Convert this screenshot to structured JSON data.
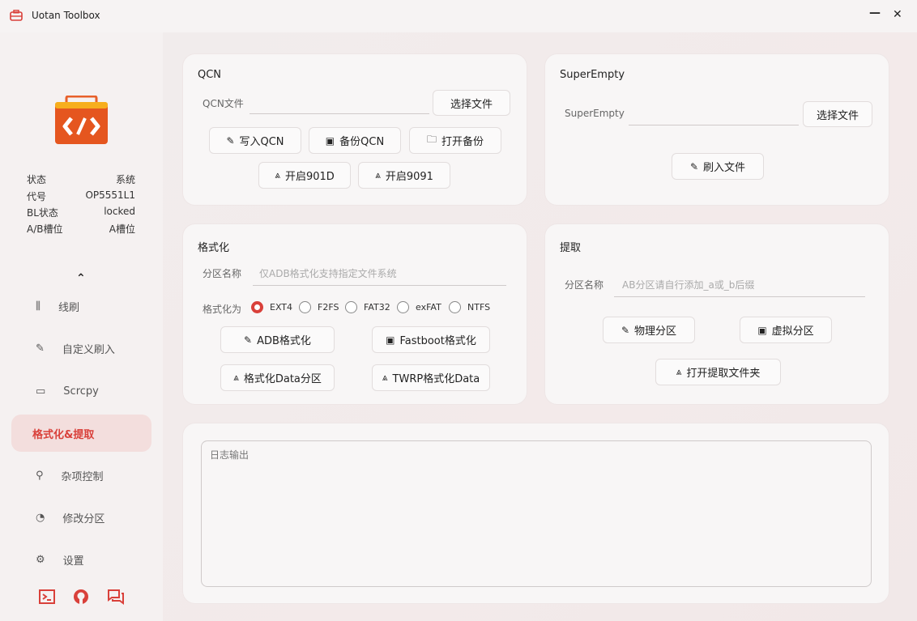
{
  "window": {
    "title": "Uotan Toolbox",
    "minimize": "—",
    "close": "✕",
    "accent": "#d9403a"
  },
  "sidebar": {
    "info": [
      {
        "k": "状态",
        "v": "系统"
      },
      {
        "k": "代号",
        "v": "OP5551L1"
      },
      {
        "k": "BL状态",
        "v": "locked"
      },
      {
        "k": "A/B槽位",
        "v": "A槽位"
      }
    ],
    "collapse": "⌃",
    "items": [
      {
        "label": "线刷",
        "icon": "flash-icon"
      },
      {
        "label": "自定义刷入",
        "icon": "wand-icon"
      },
      {
        "label": "Scrcpy",
        "icon": "devices-icon"
      },
      {
        "label": "格式化&提取",
        "icon": "",
        "active": true
      },
      {
        "label": "杂项控制",
        "icon": "tools-icon"
      },
      {
        "label": "修改分区",
        "icon": "pie-icon"
      },
      {
        "label": "设置",
        "icon": "gear-icon"
      }
    ],
    "footer": [
      "terminal-icon",
      "github-icon",
      "chat-icon"
    ]
  },
  "qcn": {
    "title": "QCN",
    "file_label": "QCN文件",
    "file_value": "",
    "choose": "选择文件",
    "write": "写入QCN",
    "backup": "备份QCN",
    "open_backup": "打开备份",
    "enable901d": "开启901D",
    "enable9091": "开启9091"
  },
  "superempty": {
    "title": "SuperEmpty",
    "file_label": "SuperEmpty",
    "file_value": "",
    "choose": "选择文件",
    "flash": "刷入文件"
  },
  "format": {
    "title": "格式化",
    "part_label": "分区名称",
    "part_placeholder": "仅ADB格式化支持指定文件系统",
    "fs_label": "格式化为",
    "fs_options": [
      "EXT4",
      "F2FS",
      "FAT32",
      "exFAT",
      "NTFS"
    ],
    "selected": "EXT4",
    "adb": "ADB格式化",
    "fastboot": "Fastboot格式化",
    "data": "格式化Data分区",
    "twrp": "TWRP格式化Data"
  },
  "extract": {
    "title": "提取",
    "part_label": "分区名称",
    "part_placeholder": "AB分区请自行添加_a或_b后缀",
    "physical": "物理分区",
    "virtual": "虚拟分区",
    "open_folder": "打开提取文件夹"
  },
  "log": {
    "placeholder": "日志输出"
  }
}
